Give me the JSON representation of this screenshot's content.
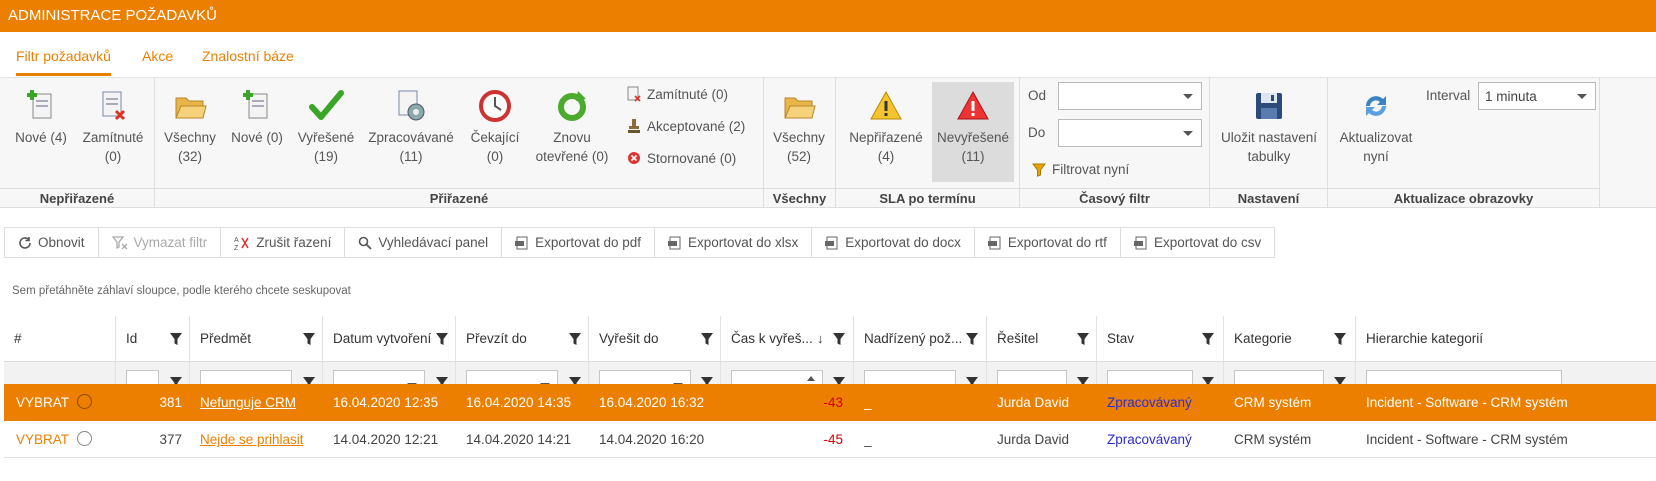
{
  "app": {
    "title": "ADMINISTRACE POŽADAVKŮ"
  },
  "tabs": [
    {
      "label": "Filtr požadavků",
      "active": true
    },
    {
      "label": "Akce",
      "active": false
    },
    {
      "label": "Znalostní báze",
      "active": false
    }
  ],
  "ribbon": {
    "unassigned": {
      "label": "Nepřiřazené",
      "buttons": [
        {
          "line1": "Nové (4)",
          "line2": ""
        },
        {
          "line1": "Zamítnuté",
          "line2": "(0)"
        }
      ]
    },
    "assigned": {
      "label": "Přiřazené",
      "buttons": [
        {
          "line1": "Všechny",
          "line2": "(32)"
        },
        {
          "line1": "Nové (0)",
          "line2": ""
        },
        {
          "line1": "Vyřešené",
          "line2": "(19)"
        },
        {
          "line1": "Zpracovávané",
          "line2": "(11)"
        },
        {
          "line1": "Čekající",
          "line2": "(0)"
        },
        {
          "line1": "Znovu",
          "line2": "otevřené (0)"
        }
      ],
      "small": [
        "Zamítnuté (0)",
        "Akceptované (2)",
        "Stornované (0)"
      ]
    },
    "all": {
      "label": "Všechny",
      "button": {
        "line1": "Všechny",
        "line2": "(52)"
      }
    },
    "sla": {
      "label": "SLA po termínu",
      "buttons": [
        {
          "line1": "Nepřiřazené",
          "line2": "(4)"
        },
        {
          "line1": "Nevyřešené",
          "line2": "(11)"
        }
      ]
    },
    "time": {
      "label": "Časový filtr",
      "from_label": "Od",
      "to_label": "Do",
      "from_value": "",
      "to_value": "",
      "filter_now": "Filtrovat nyní"
    },
    "settings": {
      "label": "Nastavení",
      "save_line1": "Uložit nastavení",
      "save_line2": "tabulky"
    },
    "refresh": {
      "label": "Aktualizace obrazovky",
      "update_line1": "Aktualizovat",
      "update_line2": "nyní",
      "interval_label": "Interval",
      "interval_value": "1 minuta"
    }
  },
  "toolbar": {
    "refresh": "Obnovit",
    "clear_filter": "Vymazat filtr",
    "cancel_sort": "Zrušit řazení",
    "search_panel": "Vyhledávací panel",
    "export_pdf": "Exportovat do pdf",
    "export_xlsx": "Exportovat do xlsx",
    "export_docx": "Exportovat do docx",
    "export_rtf": "Exportovat do rtf",
    "export_csv": "Exportovat do csv"
  },
  "group_hint": "Sem přetáhněte záhlaví sloupce, podle kterého chcete seskupovat",
  "grid": {
    "columns": [
      "#",
      "Id",
      "Předmět",
      "Datum vytvoření",
      "Převzít do",
      "Vyřešit do",
      "Čas k vyřeš...",
      "Nadřízený pož...",
      "Řešitel",
      "Stav",
      "Kategorie",
      "Hierarchie kategorií"
    ],
    "rows": [
      {
        "select": "VYBRAT",
        "id": "381",
        "subject": "Nefunguje CRM",
        "created": "16.04.2020 12:35",
        "take_by": "16.04.2020 14:35",
        "solve_by": "16.04.2020 16:32",
        "time_left": "-43",
        "parent": "_",
        "solver": "Jurda David",
        "status": "Zpracovávaný",
        "category": "CRM systém",
        "hierarchy": "Incident - Software - CRM systém",
        "selected": true
      },
      {
        "select": "VYBRAT",
        "id": "377",
        "subject": "Nejde se prihlasit",
        "created": "14.04.2020 12:21",
        "take_by": "14.04.2020 14:21",
        "solve_by": "14.04.2020 16:20",
        "time_left": "-45",
        "parent": "_",
        "solver": "Jurda David",
        "status": "Zpracovávaný",
        "category": "CRM systém",
        "hierarchy": "Incident - Software - CRM systém",
        "selected": false
      }
    ]
  },
  "colors": {
    "accent": "#ec7f00",
    "status": "#2b2bd8",
    "negative": "#d00000"
  }
}
